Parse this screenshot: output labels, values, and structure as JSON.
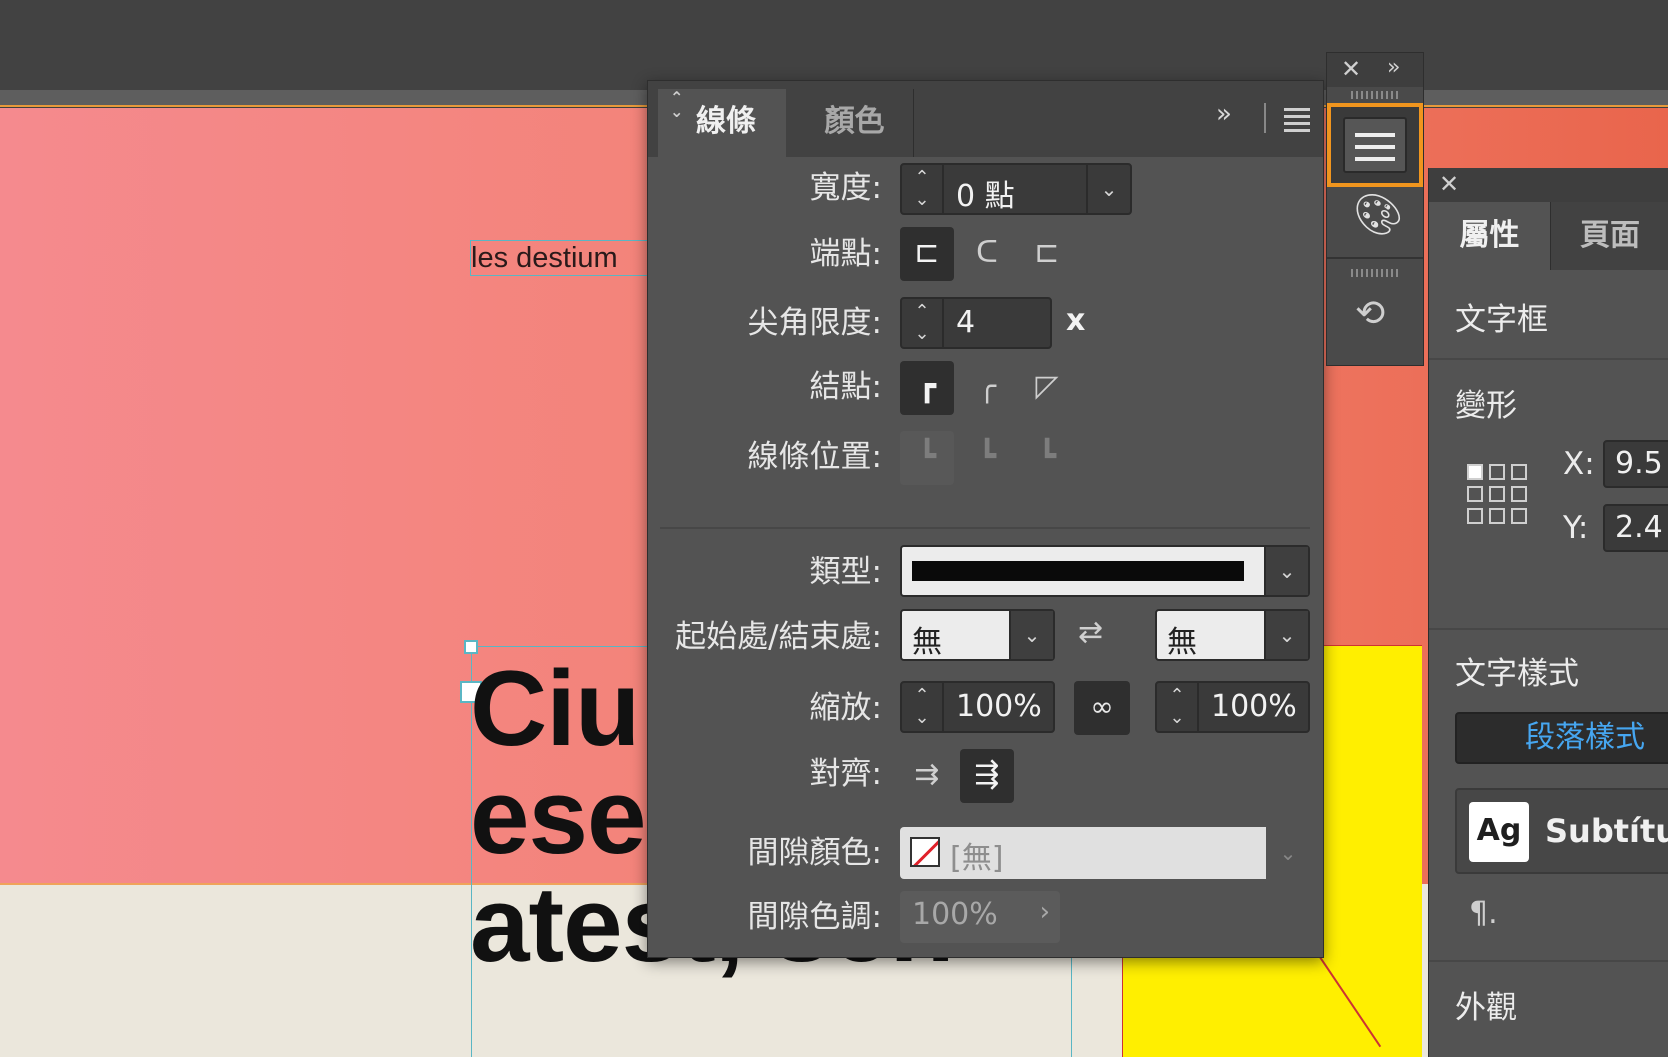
{
  "canvas": {
    "small_text": "les destium",
    "big_text_lines": [
      "Ciu",
      "ese",
      "atest, sen-"
    ]
  },
  "stroke_panel": {
    "tabs": [
      {
        "label": "線條",
        "active": true
      },
      {
        "label": "顏色",
        "active": false
      }
    ],
    "more_label": "»",
    "weight": {
      "label": "寬度:",
      "value": "0 點"
    },
    "cap": {
      "label": "端點:"
    },
    "miter": {
      "label": "尖角限度:",
      "value": "4",
      "unit": "x"
    },
    "join": {
      "label": "結點:"
    },
    "align_stroke": {
      "label": "線條位置:"
    },
    "type": {
      "label": "類型:"
    },
    "start_end": {
      "label": "起始處/結束處:",
      "start": "無",
      "end": "無"
    },
    "scale": {
      "label": "縮放:",
      "start": "100%",
      "end": "100%"
    },
    "align": {
      "label": "對齊:"
    },
    "gap_color": {
      "label": "間隙顏色:",
      "value": "[無]"
    },
    "gap_tint": {
      "label": "間隙色調:",
      "value": "100%"
    }
  },
  "properties_panel": {
    "tabs": [
      "屬性",
      "頁面"
    ],
    "object_type": "文字框",
    "transform_title": "變形",
    "x_label": "X:",
    "x_value": "9.5",
    "y_label": "Y:",
    "y_value": "2.4",
    "text_style_title": "文字樣式",
    "paragraph_style_label": "段落樣式",
    "style_thumb": "Ag",
    "style_name": "Subtítul",
    "appearance_title": "外觀"
  },
  "colors": {
    "accent_selected": "#f0951e",
    "link_blue": "#46a6f0",
    "canvas_red": "#f2806f",
    "canvas_yellow": "#ffef00"
  }
}
